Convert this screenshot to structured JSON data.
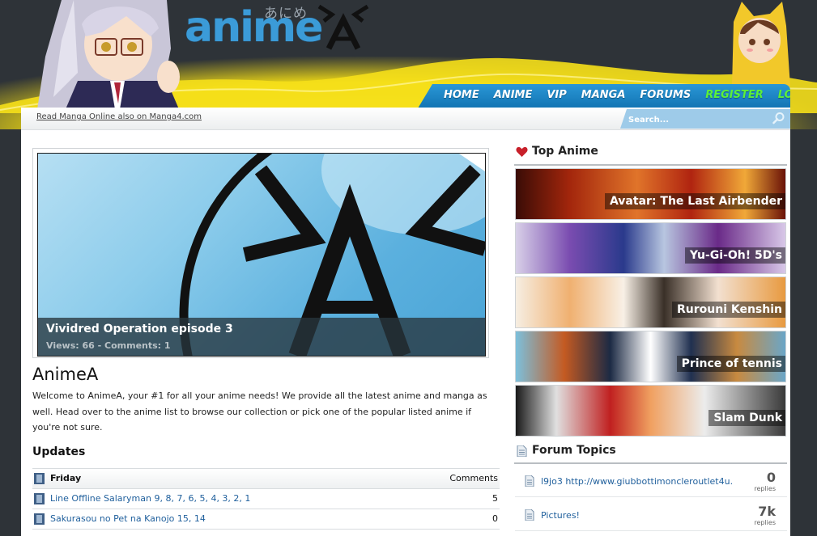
{
  "logo": {
    "text": "anime",
    "kana": "あにめ"
  },
  "nav": {
    "items": [
      {
        "label": "HOME",
        "accent": false
      },
      {
        "label": "ANIME",
        "accent": false
      },
      {
        "label": "VIP",
        "accent": false
      },
      {
        "label": "MANGA",
        "accent": false
      },
      {
        "label": "FORUMS",
        "accent": false
      },
      {
        "label": "REGISTER",
        "accent": true
      },
      {
        "label": "LOGIN",
        "accent": true
      }
    ]
  },
  "subbar": {
    "link": "Read Manga Online also on Manga4.com",
    "search_placeholder": "Search..."
  },
  "featured": {
    "title": "Vividred Operation episode 3",
    "meta": "Views: 66 - Comments: 1"
  },
  "main": {
    "title": "AnimeA",
    "intro": "Welcome to AnimeA, your #1 for all your anime needs! We provide all the latest anime and manga as well. Head over to the anime list to browse our collection or pick one of the popular listed anime if you're not sure.",
    "updates_heading": "Updates"
  },
  "updates": {
    "day": "Friday",
    "comments_header": "Comments",
    "rows": [
      {
        "title": "Line Offline Salaryman 9, 8, 7, 6, 5, 4, 3, 2, 1",
        "comments": "5"
      },
      {
        "title": "Sakurasou no Pet na Kanojo 15, 14",
        "comments": "0"
      }
    ]
  },
  "sidebar": {
    "top_anime_heading": "Top Anime",
    "top_anime": [
      {
        "name": "Avatar: The Last Airbender"
      },
      {
        "name": "Yu-Gi-Oh! 5D's"
      },
      {
        "name": "Rurouni Kenshin"
      },
      {
        "name": "Prince of tennis"
      },
      {
        "name": "Slam Dunk"
      }
    ],
    "forum_heading": "Forum Topics",
    "forum_topics": [
      {
        "title": "l9jo3 http://www.giubbottimoncleroutlet4u.",
        "count": "0",
        "label": "replies"
      },
      {
        "title": "Pictures!",
        "count": "7k",
        "label": "replies"
      }
    ]
  },
  "colors": {
    "background": "#2e3338",
    "nav_blue": "#1f86c6",
    "nav_accent": "#5cf03a",
    "link": "#1f5f9c",
    "logo_blue": "#3b9bd8",
    "glow_yellow": "#f2dc14"
  }
}
